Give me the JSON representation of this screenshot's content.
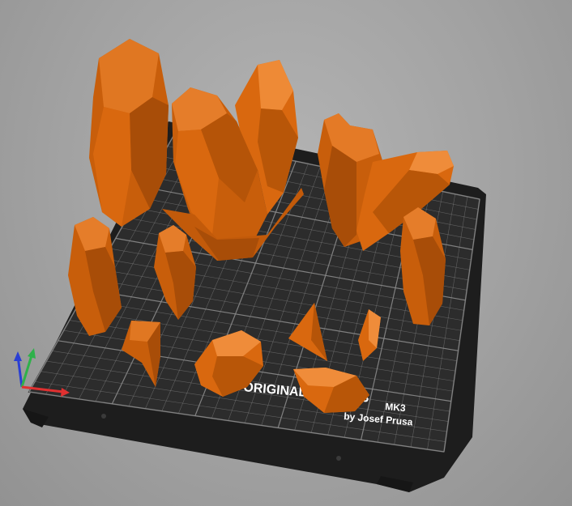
{
  "viewport": {
    "label": "3D build plate preview",
    "background_color": "#a6a6a6"
  },
  "bed": {
    "brand_text": "ORIGINAL PRUSA i3",
    "model_text": "MK3",
    "author_text": "by Josef Prusa",
    "surface_color": "#2c2c2c",
    "grid_color": "#8a8a8a",
    "frame_color": "#1e1e1e"
  },
  "objects": {
    "color": "#d9680f",
    "shape": "low-poly crystal",
    "count": 13
  },
  "axes_gizmo": {
    "x_color": "#e03030",
    "y_color": "#2fb14a",
    "z_color": "#2a3fd4"
  }
}
